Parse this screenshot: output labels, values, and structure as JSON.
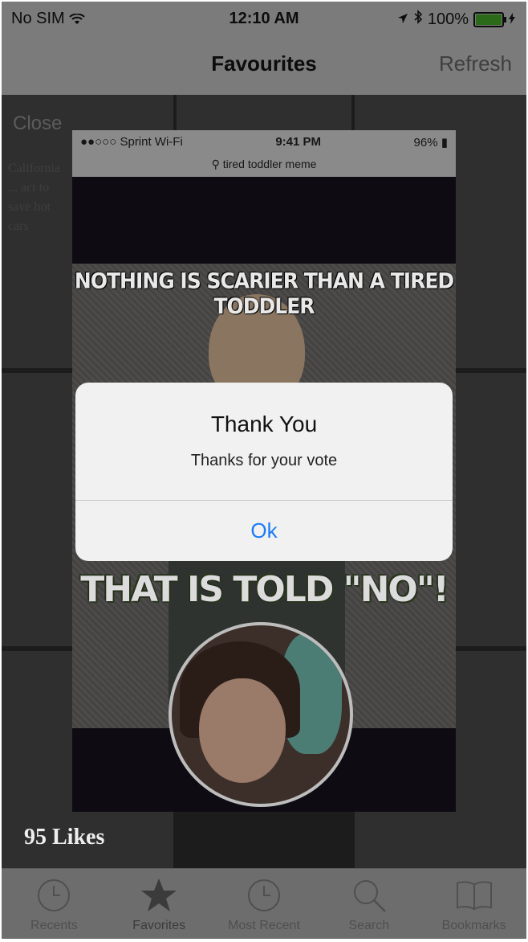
{
  "status_bar": {
    "carrier": "No SIM",
    "time": "12:10 AM",
    "battery": "100%"
  },
  "nav": {
    "title": "Favourites",
    "refresh_label": "Refresh"
  },
  "background": {
    "close_label": "Close",
    "article_text": "California ... act to save hot cars"
  },
  "inner_screenshot": {
    "carrier": "Sprint Wi-Fi",
    "time": "9:41 PM",
    "battery": "96%",
    "search_query": "tired toddler meme"
  },
  "meme": {
    "top_text": "NOTHING IS SCARIER THAN A TIRED TODDLER",
    "bottom_text": "THAT IS TOLD \"NO\"!"
  },
  "likes": "95 Likes",
  "alert": {
    "title": "Thank You",
    "message": "Thanks for your vote",
    "ok_label": "Ok",
    "button_color": "#1a7cf5"
  },
  "tabs": [
    {
      "label": "Recents",
      "icon": "clock-icon"
    },
    {
      "label": "Favorites",
      "icon": "star-icon"
    },
    {
      "label": "Most Recent",
      "icon": "clock-icon"
    },
    {
      "label": "Search",
      "icon": "search-icon"
    },
    {
      "label": "Bookmarks",
      "icon": "book-icon"
    }
  ]
}
